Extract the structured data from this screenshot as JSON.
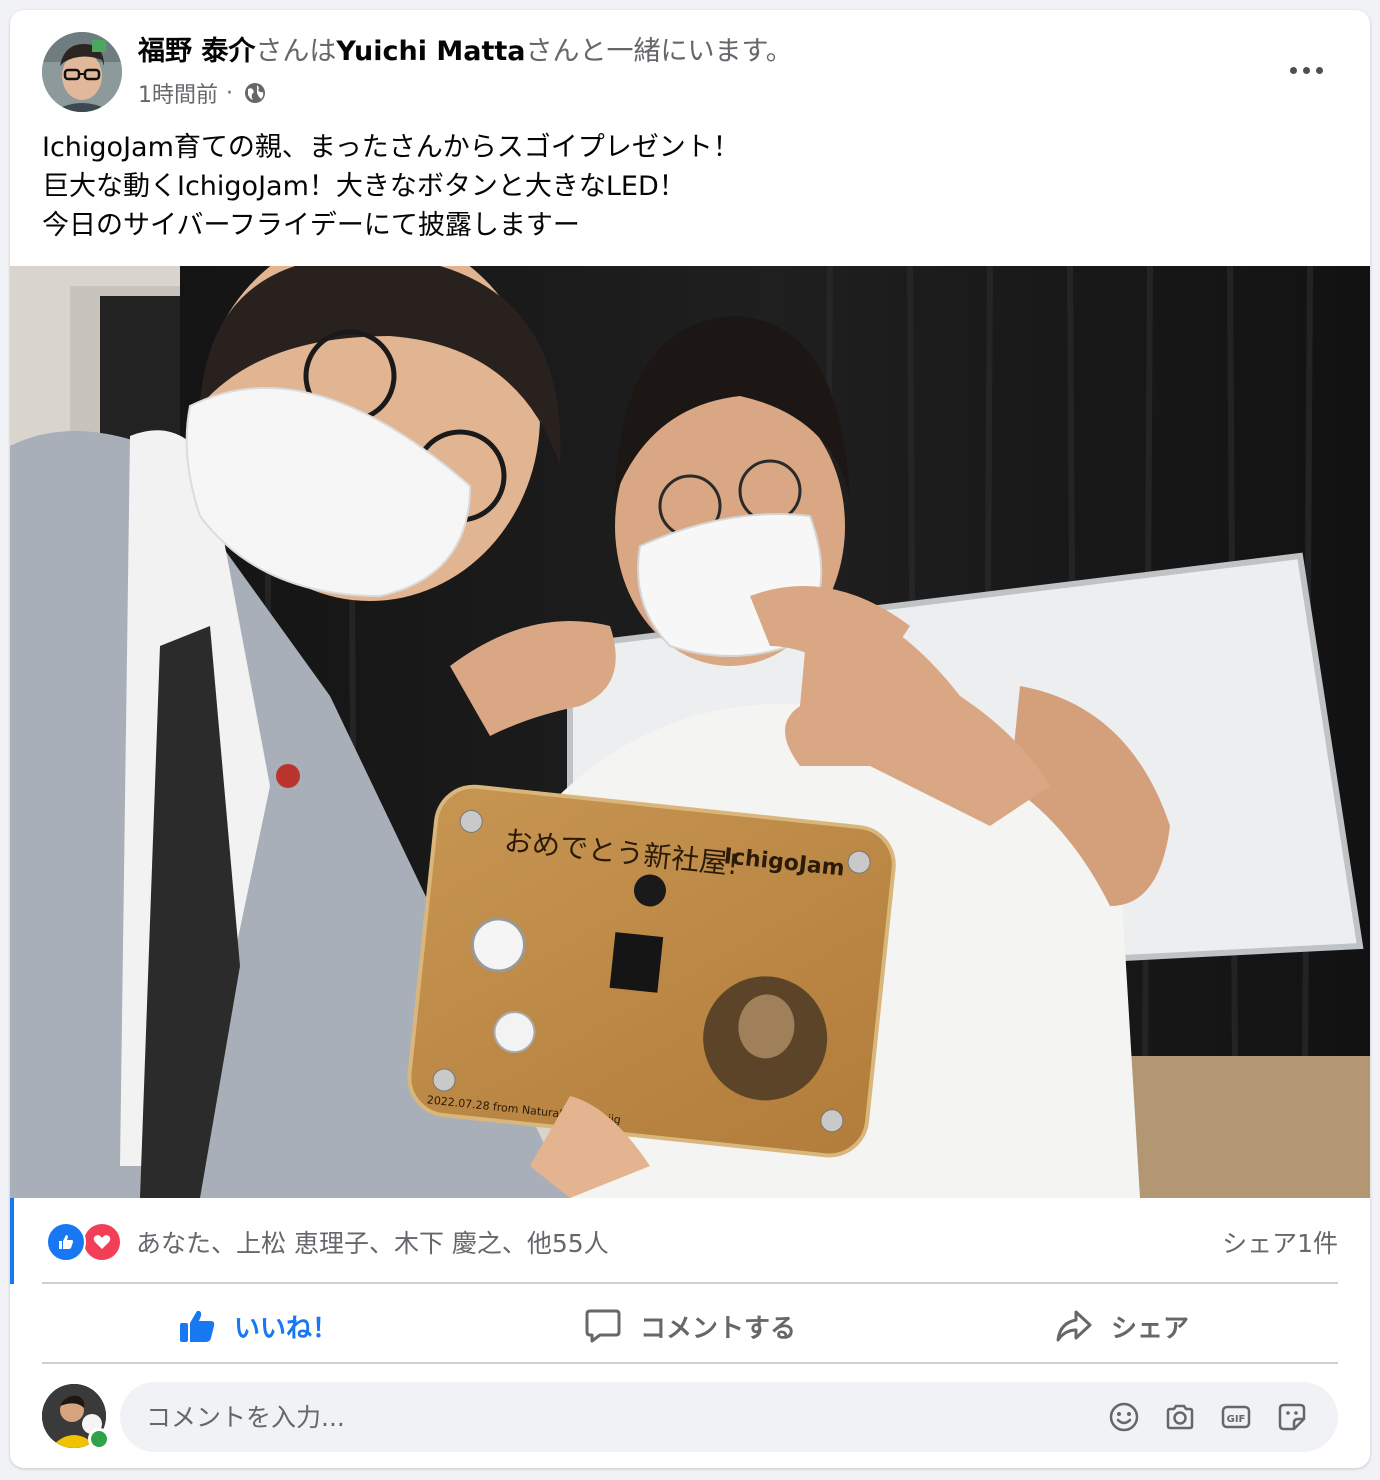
{
  "post": {
    "author": "福野 泰介",
    "with_connector": "さんは",
    "tagged_user": "Yuichi Matta",
    "with_suffix": "さんと一緒にいます。",
    "timestamp": "1時間前",
    "separator": "·",
    "privacy_icon": "globe-icon",
    "text_lines": [
      "IchigoJam育ての親、まったさんからスゴイプレゼント！",
      "巨大な動くIchigoJam！大きなボタンと大きなLED！",
      "今日のサイバーフライデーにて披露しますー"
    ],
    "board_message": "おめでとう新社屋!",
    "board_logo": "IchigoJam",
    "board_date": "2022.07.28 from NaturalStyle to jig"
  },
  "reactions": {
    "icons": [
      "like-icon",
      "love-icon"
    ],
    "names": "あなた、上松 恵理子、木下 慶之、他55人",
    "share_count": "シェア1件"
  },
  "actions": {
    "like": "いいね！",
    "comment": "コメントする",
    "share": "シェア"
  },
  "composer": {
    "placeholder": "コメントを入力...",
    "tools": [
      "emoji-icon",
      "camera-icon",
      "gif-icon",
      "sticker-icon"
    ]
  },
  "colors": {
    "accent": "#1877f2",
    "love": "#f33e58",
    "muted": "#65676b",
    "online": "#31a24c"
  }
}
